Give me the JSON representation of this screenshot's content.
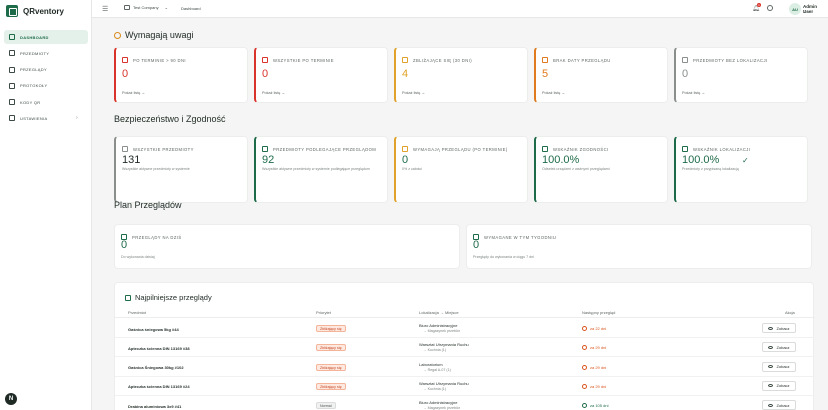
{
  "app": {
    "name": "QRventory"
  },
  "sidebar": {
    "items": [
      {
        "label": "DASHBOARD",
        "active": true
      },
      {
        "label": "PRZEDMIOTY"
      },
      {
        "label": "PRZEGLĄDY"
      },
      {
        "label": "PROTOKOŁY"
      },
      {
        "label": "KODY QR"
      },
      {
        "label": "USTAWIENIA",
        "chevron": "›"
      }
    ],
    "bottom_button": "N"
  },
  "topbar": {
    "company": "Test Company",
    "company_chevron": "⌄",
    "breadcrumb": "Dashboard",
    "notification_count": "1",
    "avatar_initials": "AU",
    "user_name": "Admin User",
    "user_role": "Admin"
  },
  "attention": {
    "title": "Wymagają uwagi",
    "cards": [
      {
        "label": "PO TERMINIE > 90 DNI",
        "value": "0",
        "link": "Pokaż listę →",
        "color": "#d9342b"
      },
      {
        "label": "WSZYSTKIE PO TERMINIE",
        "value": "0",
        "link": "Pokaż listę →",
        "color": "#d9342b"
      },
      {
        "label": "ZBLIŻAJĄCE SIĘ (30 DNI)",
        "value": "4",
        "link": "Pokaż listę →",
        "color": "#e0a22a"
      },
      {
        "label": "BRAK DATY PRZEGLĄDU",
        "value": "5",
        "link": "Pokaż listę →",
        "color": "#e07a1e"
      },
      {
        "label": "PRZEDMIOTY BEZ LOKALIZACJI",
        "value": "0",
        "link": "Pokaż listę →",
        "color": "#8a8f8c"
      }
    ]
  },
  "safety": {
    "title": "Bezpieczeństwo i Zgodność",
    "cards": [
      {
        "label": "WSZYSTKIE PRZEDMIOTY",
        "value": "131",
        "desc": "Wszystkie aktywne przedmioty w systemie",
        "color": "#8a8f8c",
        "value_color": "#1f2a24"
      },
      {
        "label": "PRZEDMIOTY PODLEGAJĄCE PRZEGLĄDOM",
        "value": "92",
        "desc": "Wszystkie aktywne przedmioty w systemie podlegające przeglądom",
        "color": "#1e6b4a",
        "value_color": "#1e6b4a"
      },
      {
        "label": "WYMAGAJĄ PRZEGLĄDU (PO TERMINIE)",
        "value": "0",
        "desc": "0% z całości",
        "color": "#e0a22a",
        "value_color": "#1e6b4a"
      },
      {
        "label": "WSKAŹNIK ZGODNOŚCI",
        "value": "100.0%",
        "desc": "Odsetek urządzeń z ważnymi przeglądami",
        "color": "#1e6b4a",
        "value_color": "#1e6b4a"
      },
      {
        "label": "WSKAŹNIK LOKALIZACJI",
        "value": "100.0%",
        "check": "✓",
        "desc": "Przedmioty z przypisaną lokalizacją",
        "color": "#1e6b4a",
        "value_color": "#1e6b4a"
      }
    ]
  },
  "plan": {
    "title": "Plan Przeglądów",
    "cards": [
      {
        "label": "PRZEGLĄDY NA DZIŚ",
        "value": "0",
        "desc": "Do wykonania dzisiaj"
      },
      {
        "label": "WYMAGANE W TYM TYGODNIU",
        "value": "0",
        "desc": "Przeglądy do wykonania w ciągu 7 dni"
      }
    ]
  },
  "nearest": {
    "title": "Najpilniejsze przeglądy",
    "columns": [
      "Przedmiot",
      "Priorytet",
      "Lokalizacja → Miejsce",
      "Następny przegląd",
      "Akcja"
    ],
    "rows": [
      {
        "name": "Gaśnica śniegowa 5kg #44",
        "priority": "Zbliżający się",
        "ptype": "critical",
        "loc": "Biuro Administracyjne",
        "sub": "→ Magazynek przebiór",
        "due": "za 22 dni",
        "dtype": "warn",
        "action": "Zobacz"
      },
      {
        "name": "Apteczka ścienna DIN 13169 #38",
        "priority": "Zbliżający się",
        "ptype": "critical",
        "loc": "Warsztat Utrzymania Ruchu",
        "sub": "→ Kuchnia (1)",
        "due": "za 29 dni",
        "dtype": "warn",
        "action": "Zobacz"
      },
      {
        "name": "Gaśnica Śniegowa 30kg #102",
        "priority": "Zbliżający się",
        "ptype": "critical",
        "loc": "Laboratorium",
        "sub": "→ Regał A-07 (1)",
        "due": "za 29 dni",
        "dtype": "warn",
        "action": "Zobacz"
      },
      {
        "name": "Apteczka ścienna DIN 13169 #24",
        "priority": "Zbliżający się",
        "ptype": "critical",
        "loc": "Warsztat Utrzymania Ruchu",
        "sub": "→ Kuchnia (1)",
        "due": "za 29 dni",
        "dtype": "warn",
        "action": "Zobacz"
      },
      {
        "name": "Drabina aluminiowa 3x9 #41",
        "priority": "Normal",
        "ptype": "normal",
        "loc": "Biuro Administracyjne",
        "sub": "→ Magazynek przebiór",
        "due": "za 105 dni",
        "dtype": "ok",
        "action": "Zobacz"
      }
    ]
  }
}
